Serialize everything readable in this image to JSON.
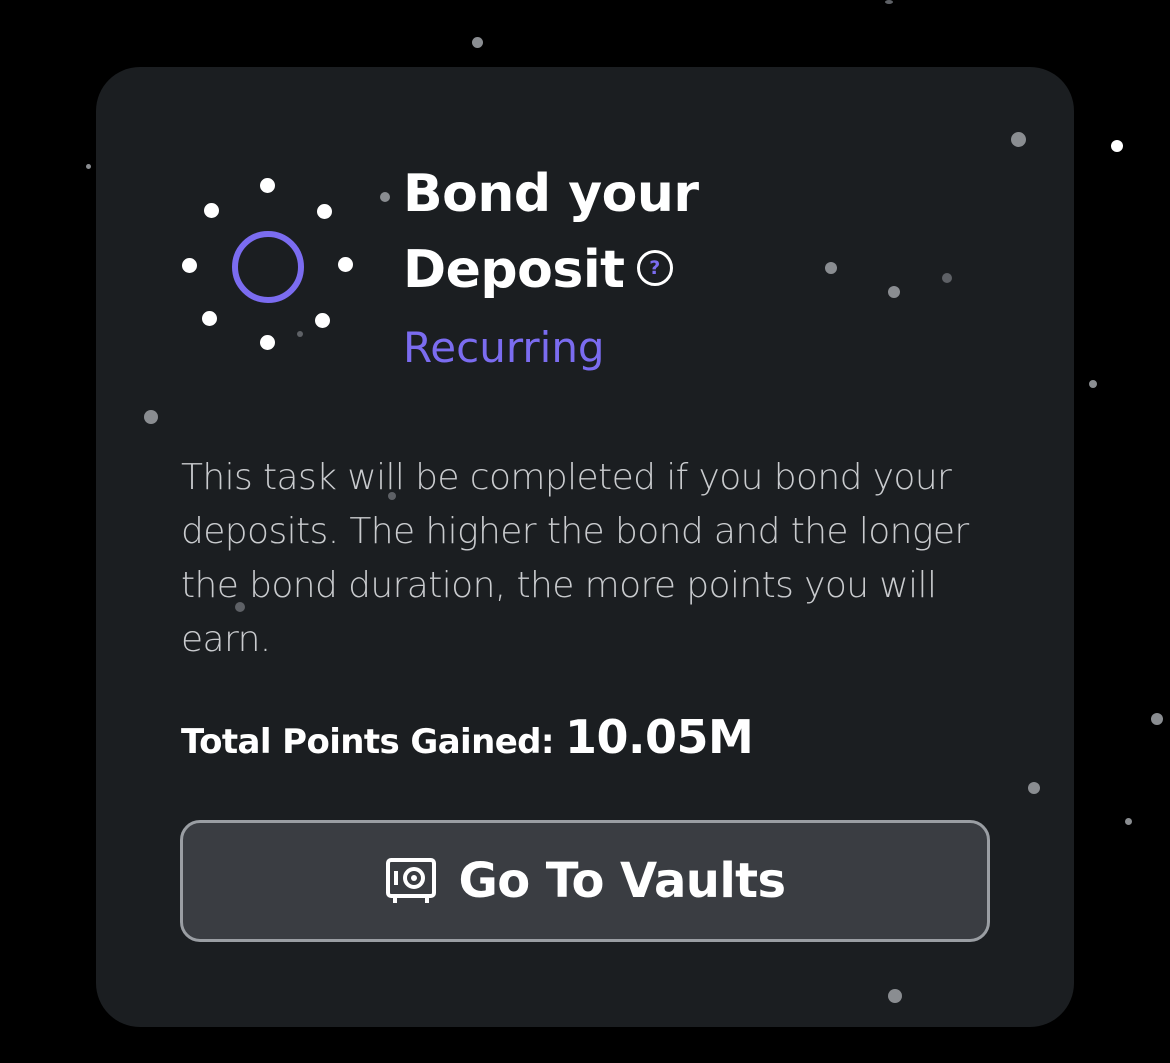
{
  "card": {
    "title_line1": "Bond your",
    "title_line2": "Deposit",
    "help_icon_glyph": "?",
    "subtitle": "Recurring",
    "description": "This task will be completed if you bond your deposits. The higher the bond and the longer the bond duration, the more points you will earn.",
    "points_label": "Total Points Gained:",
    "points_value": "10.05M",
    "button_label": "Go To Vaults",
    "button_icon": "vault-icon",
    "task_icon": "sparkle-ring-icon"
  },
  "colors": {
    "background": "#000000",
    "card": "#1b1e21",
    "accent": "#7b6cf0",
    "button_fill": "#3a3d42",
    "button_border": "#9a9ea3",
    "text_primary": "#ffffff",
    "text_secondary": "#c9cbce"
  }
}
